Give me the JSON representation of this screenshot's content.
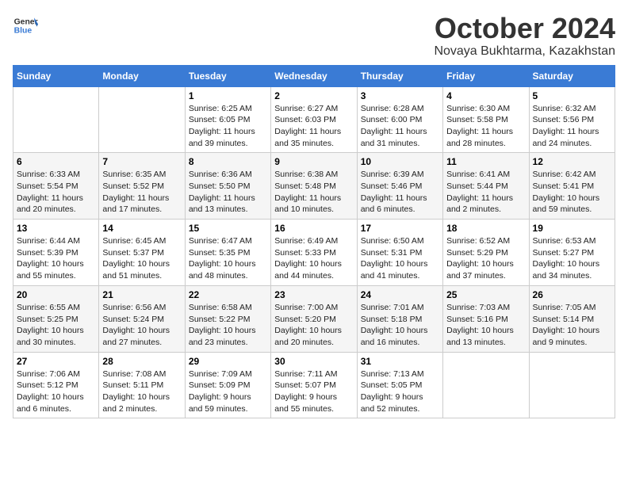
{
  "header": {
    "logo_general": "General",
    "logo_blue": "Blue",
    "month_title": "October 2024",
    "location": "Novaya Bukhtarma, Kazakhstan"
  },
  "calendar": {
    "days_of_week": [
      "Sunday",
      "Monday",
      "Tuesday",
      "Wednesday",
      "Thursday",
      "Friday",
      "Saturday"
    ],
    "weeks": [
      [
        {
          "day": "",
          "info": ""
        },
        {
          "day": "",
          "info": ""
        },
        {
          "day": "1",
          "info": "Sunrise: 6:25 AM\nSunset: 6:05 PM\nDaylight: 11 hours\nand 39 minutes."
        },
        {
          "day": "2",
          "info": "Sunrise: 6:27 AM\nSunset: 6:03 PM\nDaylight: 11 hours\nand 35 minutes."
        },
        {
          "day": "3",
          "info": "Sunrise: 6:28 AM\nSunset: 6:00 PM\nDaylight: 11 hours\nand 31 minutes."
        },
        {
          "day": "4",
          "info": "Sunrise: 6:30 AM\nSunset: 5:58 PM\nDaylight: 11 hours\nand 28 minutes."
        },
        {
          "day": "5",
          "info": "Sunrise: 6:32 AM\nSunset: 5:56 PM\nDaylight: 11 hours\nand 24 minutes."
        }
      ],
      [
        {
          "day": "6",
          "info": "Sunrise: 6:33 AM\nSunset: 5:54 PM\nDaylight: 11 hours\nand 20 minutes."
        },
        {
          "day": "7",
          "info": "Sunrise: 6:35 AM\nSunset: 5:52 PM\nDaylight: 11 hours\nand 17 minutes."
        },
        {
          "day": "8",
          "info": "Sunrise: 6:36 AM\nSunset: 5:50 PM\nDaylight: 11 hours\nand 13 minutes."
        },
        {
          "day": "9",
          "info": "Sunrise: 6:38 AM\nSunset: 5:48 PM\nDaylight: 11 hours\nand 10 minutes."
        },
        {
          "day": "10",
          "info": "Sunrise: 6:39 AM\nSunset: 5:46 PM\nDaylight: 11 hours\nand 6 minutes."
        },
        {
          "day": "11",
          "info": "Sunrise: 6:41 AM\nSunset: 5:44 PM\nDaylight: 11 hours\nand 2 minutes."
        },
        {
          "day": "12",
          "info": "Sunrise: 6:42 AM\nSunset: 5:41 PM\nDaylight: 10 hours\nand 59 minutes."
        }
      ],
      [
        {
          "day": "13",
          "info": "Sunrise: 6:44 AM\nSunset: 5:39 PM\nDaylight: 10 hours\nand 55 minutes."
        },
        {
          "day": "14",
          "info": "Sunrise: 6:45 AM\nSunset: 5:37 PM\nDaylight: 10 hours\nand 51 minutes."
        },
        {
          "day": "15",
          "info": "Sunrise: 6:47 AM\nSunset: 5:35 PM\nDaylight: 10 hours\nand 48 minutes."
        },
        {
          "day": "16",
          "info": "Sunrise: 6:49 AM\nSunset: 5:33 PM\nDaylight: 10 hours\nand 44 minutes."
        },
        {
          "day": "17",
          "info": "Sunrise: 6:50 AM\nSunset: 5:31 PM\nDaylight: 10 hours\nand 41 minutes."
        },
        {
          "day": "18",
          "info": "Sunrise: 6:52 AM\nSunset: 5:29 PM\nDaylight: 10 hours\nand 37 minutes."
        },
        {
          "day": "19",
          "info": "Sunrise: 6:53 AM\nSunset: 5:27 PM\nDaylight: 10 hours\nand 34 minutes."
        }
      ],
      [
        {
          "day": "20",
          "info": "Sunrise: 6:55 AM\nSunset: 5:25 PM\nDaylight: 10 hours\nand 30 minutes."
        },
        {
          "day": "21",
          "info": "Sunrise: 6:56 AM\nSunset: 5:24 PM\nDaylight: 10 hours\nand 27 minutes."
        },
        {
          "day": "22",
          "info": "Sunrise: 6:58 AM\nSunset: 5:22 PM\nDaylight: 10 hours\nand 23 minutes."
        },
        {
          "day": "23",
          "info": "Sunrise: 7:00 AM\nSunset: 5:20 PM\nDaylight: 10 hours\nand 20 minutes."
        },
        {
          "day": "24",
          "info": "Sunrise: 7:01 AM\nSunset: 5:18 PM\nDaylight: 10 hours\nand 16 minutes."
        },
        {
          "day": "25",
          "info": "Sunrise: 7:03 AM\nSunset: 5:16 PM\nDaylight: 10 hours\nand 13 minutes."
        },
        {
          "day": "26",
          "info": "Sunrise: 7:05 AM\nSunset: 5:14 PM\nDaylight: 10 hours\nand 9 minutes."
        }
      ],
      [
        {
          "day": "27",
          "info": "Sunrise: 7:06 AM\nSunset: 5:12 PM\nDaylight: 10 hours\nand 6 minutes."
        },
        {
          "day": "28",
          "info": "Sunrise: 7:08 AM\nSunset: 5:11 PM\nDaylight: 10 hours\nand 2 minutes."
        },
        {
          "day": "29",
          "info": "Sunrise: 7:09 AM\nSunset: 5:09 PM\nDaylight: 9 hours\nand 59 minutes."
        },
        {
          "day": "30",
          "info": "Sunrise: 7:11 AM\nSunset: 5:07 PM\nDaylight: 9 hours\nand 55 minutes."
        },
        {
          "day": "31",
          "info": "Sunrise: 7:13 AM\nSunset: 5:05 PM\nDaylight: 9 hours\nand 52 minutes."
        },
        {
          "day": "",
          "info": ""
        },
        {
          "day": "",
          "info": ""
        }
      ]
    ]
  }
}
